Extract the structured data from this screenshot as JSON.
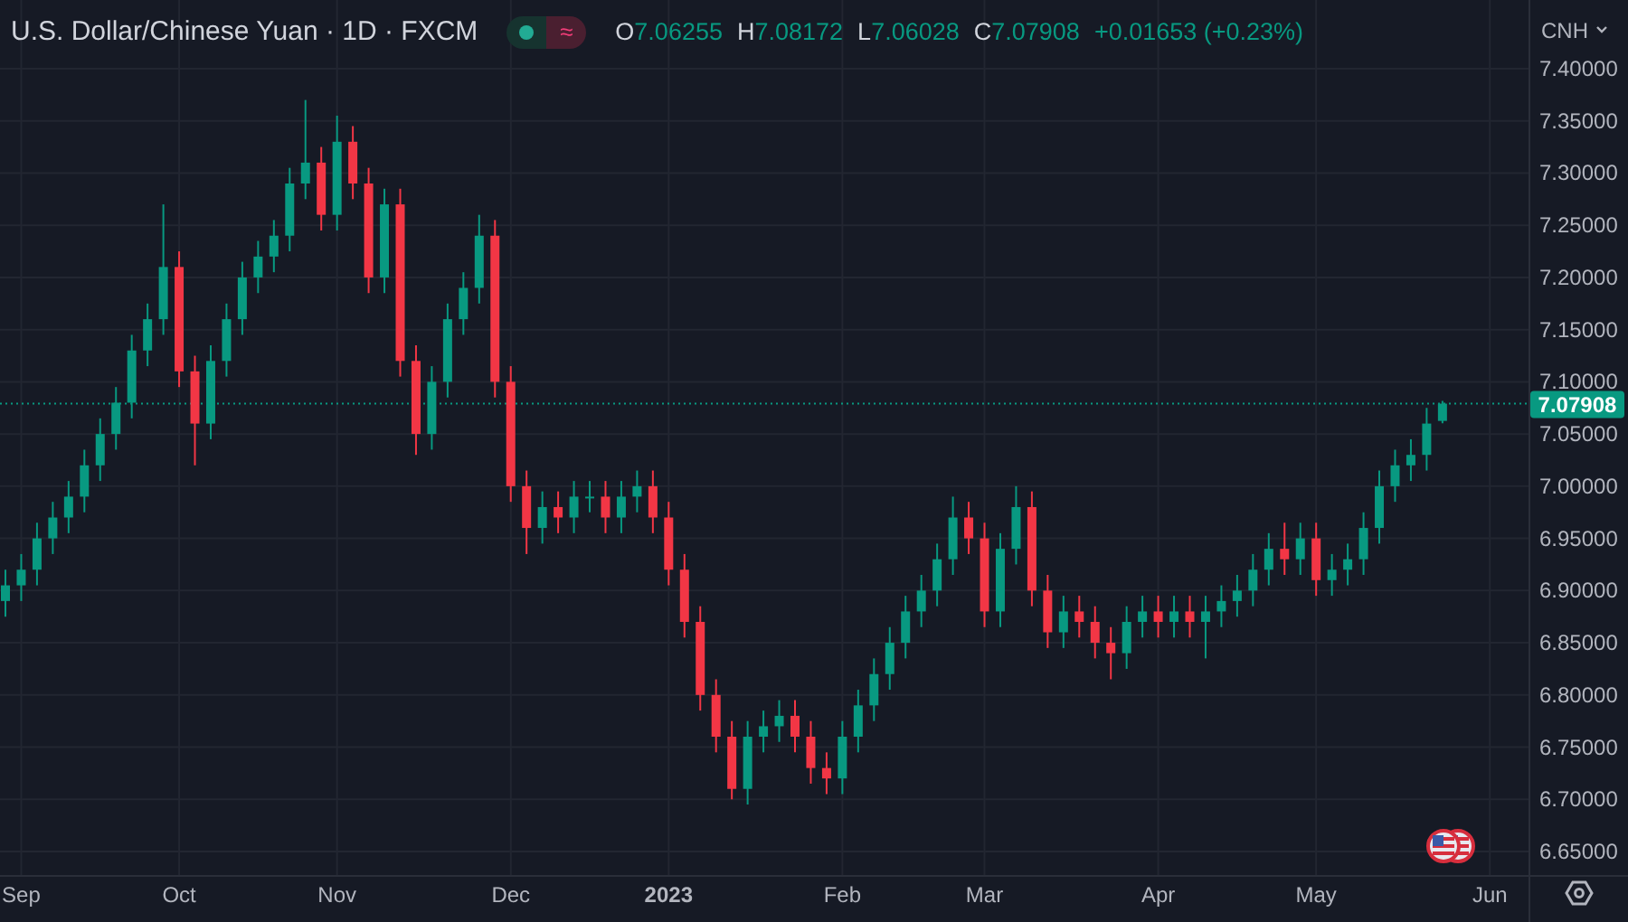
{
  "header": {
    "symbol_title": "U.S. Dollar/Chinese Yuan · 1D · FXCM",
    "market_open": true,
    "data_badge": "≈",
    "ohlc": [
      {
        "label": "O",
        "value": "7.06255"
      },
      {
        "label": "H",
        "value": "7.08172"
      },
      {
        "label": "L",
        "value": "7.06028"
      },
      {
        "label": "C",
        "value": "7.07908"
      }
    ],
    "change": "+0.01653 (+0.23%)"
  },
  "price_axis": {
    "currency": "CNH"
  },
  "chart_data": {
    "type": "candlestick",
    "grid": true,
    "ylim": [
      6.6275,
      7.4658
    ],
    "ref_lines": [
      {
        "axis": "y",
        "value": 7.07908,
        "color": "#089981",
        "label": "7.07908"
      }
    ],
    "categories": [
      null,
      "Sep",
      null,
      null,
      null,
      null,
      null,
      null,
      null,
      null,
      null,
      "Oct",
      null,
      null,
      null,
      null,
      null,
      null,
      null,
      null,
      null,
      "Nov",
      null,
      null,
      null,
      null,
      null,
      null,
      null,
      null,
      null,
      null,
      "Dec",
      null,
      null,
      null,
      null,
      null,
      null,
      null,
      null,
      null,
      "2023",
      null,
      null,
      null,
      null,
      null,
      null,
      null,
      null,
      null,
      null,
      "Feb",
      null,
      null,
      null,
      null,
      null,
      null,
      null,
      null,
      "Mar",
      null,
      null,
      null,
      null,
      null,
      null,
      null,
      null,
      null,
      null,
      "Apr",
      null,
      null,
      null,
      null,
      null,
      null,
      null,
      null,
      null,
      "May",
      null,
      null,
      null,
      null,
      null,
      null,
      null,
      null,
      null,
      null,
      "Jun"
    ],
    "yticks": [
      {
        "value": 7.4,
        "label": "7.40000"
      },
      {
        "value": 7.35,
        "label": "7.35000"
      },
      {
        "value": 7.3,
        "label": "7.30000"
      },
      {
        "value": 7.25,
        "label": "7.25000"
      },
      {
        "value": 7.2,
        "label": "7.20000"
      },
      {
        "value": 7.15,
        "label": "7.15000"
      },
      {
        "value": 7.1,
        "label": "7.10000"
      },
      {
        "value": 7.05,
        "label": "7.05000"
      },
      {
        "value": 7.0,
        "label": "7.00000"
      },
      {
        "value": 6.95,
        "label": "6.95000"
      },
      {
        "value": 6.9,
        "label": "6.90000"
      },
      {
        "value": 6.85,
        "label": "6.85000"
      },
      {
        "value": 6.8,
        "label": "6.80000"
      },
      {
        "value": 6.75,
        "label": "6.75000"
      },
      {
        "value": 6.7,
        "label": "6.70000"
      },
      {
        "value": 6.65,
        "label": "6.65000"
      }
    ],
    "ohlc": [
      [
        6.89,
        6.92,
        6.875,
        6.905
      ],
      [
        6.905,
        6.935,
        6.89,
        6.92
      ],
      [
        6.92,
        6.965,
        6.905,
        6.95
      ],
      [
        6.95,
        6.985,
        6.935,
        6.97
      ],
      [
        6.97,
        7.005,
        6.955,
        6.99
      ],
      [
        6.99,
        7.035,
        6.975,
        7.02
      ],
      [
        7.02,
        7.065,
        7.005,
        7.05
      ],
      [
        7.05,
        7.095,
        7.035,
        7.08
      ],
      [
        7.08,
        7.145,
        7.065,
        7.13
      ],
      [
        7.13,
        7.175,
        7.115,
        7.16
      ],
      [
        7.16,
        7.27,
        7.145,
        7.21
      ],
      [
        7.21,
        7.225,
        7.095,
        7.11
      ],
      [
        7.11,
        7.125,
        7.02,
        7.06
      ],
      [
        7.06,
        7.135,
        7.045,
        7.12
      ],
      [
        7.12,
        7.175,
        7.105,
        7.16
      ],
      [
        7.16,
        7.215,
        7.145,
        7.2
      ],
      [
        7.2,
        7.235,
        7.185,
        7.22
      ],
      [
        7.22,
        7.255,
        7.205,
        7.24
      ],
      [
        7.24,
        7.305,
        7.225,
        7.29
      ],
      [
        7.29,
        7.37,
        7.275,
        7.31
      ],
      [
        7.31,
        7.325,
        7.245,
        7.26
      ],
      [
        7.26,
        7.355,
        7.245,
        7.33
      ],
      [
        7.33,
        7.345,
        7.275,
        7.29
      ],
      [
        7.29,
        7.305,
        7.185,
        7.2
      ],
      [
        7.2,
        7.285,
        7.185,
        7.27
      ],
      [
        7.27,
        7.285,
        7.105,
        7.12
      ],
      [
        7.12,
        7.135,
        7.03,
        7.05
      ],
      [
        7.05,
        7.115,
        7.035,
        7.1
      ],
      [
        7.1,
        7.175,
        7.085,
        7.16
      ],
      [
        7.16,
        7.205,
        7.145,
        7.19
      ],
      [
        7.19,
        7.26,
        7.175,
        7.24
      ],
      [
        7.24,
        7.255,
        7.085,
        7.1
      ],
      [
        7.1,
        7.115,
        6.985,
        7.0
      ],
      [
        7.0,
        7.015,
        6.935,
        6.96
      ],
      [
        6.96,
        6.995,
        6.945,
        6.98
      ],
      [
        6.98,
        6.995,
        6.955,
        6.97
      ],
      [
        6.97,
        7.005,
        6.955,
        6.99
      ],
      [
        6.99,
        7.005,
        6.975,
        6.99
      ],
      [
        6.99,
        7.005,
        6.955,
        6.97
      ],
      [
        6.97,
        7.005,
        6.955,
        6.99
      ],
      [
        6.99,
        7.015,
        6.975,
        7.0
      ],
      [
        7.0,
        7.015,
        6.955,
        6.97
      ],
      [
        6.97,
        6.985,
        6.905,
        6.92
      ],
      [
        6.92,
        6.935,
        6.855,
        6.87
      ],
      [
        6.87,
        6.885,
        6.785,
        6.8
      ],
      [
        6.8,
        6.815,
        6.745,
        6.76
      ],
      [
        6.76,
        6.775,
        6.7,
        6.71
      ],
      [
        6.71,
        6.775,
        6.695,
        6.76
      ],
      [
        6.76,
        6.785,
        6.745,
        6.77
      ],
      [
        6.77,
        6.795,
        6.755,
        6.78
      ],
      [
        6.78,
        6.795,
        6.745,
        6.76
      ],
      [
        6.76,
        6.775,
        6.715,
        6.73
      ],
      [
        6.73,
        6.745,
        6.705,
        6.72
      ],
      [
        6.72,
        6.775,
        6.705,
        6.76
      ],
      [
        6.76,
        6.805,
        6.745,
        6.79
      ],
      [
        6.79,
        6.835,
        6.775,
        6.82
      ],
      [
        6.82,
        6.865,
        6.805,
        6.85
      ],
      [
        6.85,
        6.895,
        6.835,
        6.88
      ],
      [
        6.88,
        6.915,
        6.865,
        6.9
      ],
      [
        6.9,
        6.945,
        6.885,
        6.93
      ],
      [
        6.93,
        6.99,
        6.915,
        6.97
      ],
      [
        6.97,
        6.985,
        6.935,
        6.95
      ],
      [
        6.95,
        6.965,
        6.865,
        6.88
      ],
      [
        6.88,
        6.955,
        6.865,
        6.94
      ],
      [
        6.94,
        7.0,
        6.925,
        6.98
      ],
      [
        6.98,
        6.995,
        6.885,
        6.9
      ],
      [
        6.9,
        6.915,
        6.845,
        6.86
      ],
      [
        6.86,
        6.895,
        6.845,
        6.88
      ],
      [
        6.88,
        6.895,
        6.855,
        6.87
      ],
      [
        6.87,
        6.885,
        6.835,
        6.85
      ],
      [
        6.85,
        6.865,
        6.815,
        6.84
      ],
      [
        6.84,
        6.885,
        6.825,
        6.87
      ],
      [
        6.87,
        6.895,
        6.855,
        6.88
      ],
      [
        6.88,
        6.895,
        6.855,
        6.87
      ],
      [
        6.87,
        6.895,
        6.855,
        6.88
      ],
      [
        6.88,
        6.895,
        6.855,
        6.87
      ],
      [
        6.87,
        6.895,
        6.835,
        6.88
      ],
      [
        6.88,
        6.905,
        6.865,
        6.89
      ],
      [
        6.89,
        6.915,
        6.875,
        6.9
      ],
      [
        6.9,
        6.935,
        6.885,
        6.92
      ],
      [
        6.92,
        6.955,
        6.905,
        6.94
      ],
      [
        6.94,
        6.965,
        6.915,
        6.93
      ],
      [
        6.93,
        6.965,
        6.915,
        6.95
      ],
      [
        6.95,
        6.965,
        6.895,
        6.91
      ],
      [
        6.91,
        6.935,
        6.895,
        6.92
      ],
      [
        6.92,
        6.945,
        6.905,
        6.93
      ],
      [
        6.93,
        6.975,
        6.915,
        6.96
      ],
      [
        6.96,
        7.015,
        6.945,
        7.0
      ],
      [
        7.0,
        7.035,
        6.985,
        7.02
      ],
      [
        7.02,
        7.045,
        7.005,
        7.03
      ],
      [
        7.03,
        7.075,
        7.015,
        7.06
      ],
      [
        7.06255,
        7.08172,
        7.06028,
        7.07908
      ],
      null,
      null,
      null
    ]
  }
}
